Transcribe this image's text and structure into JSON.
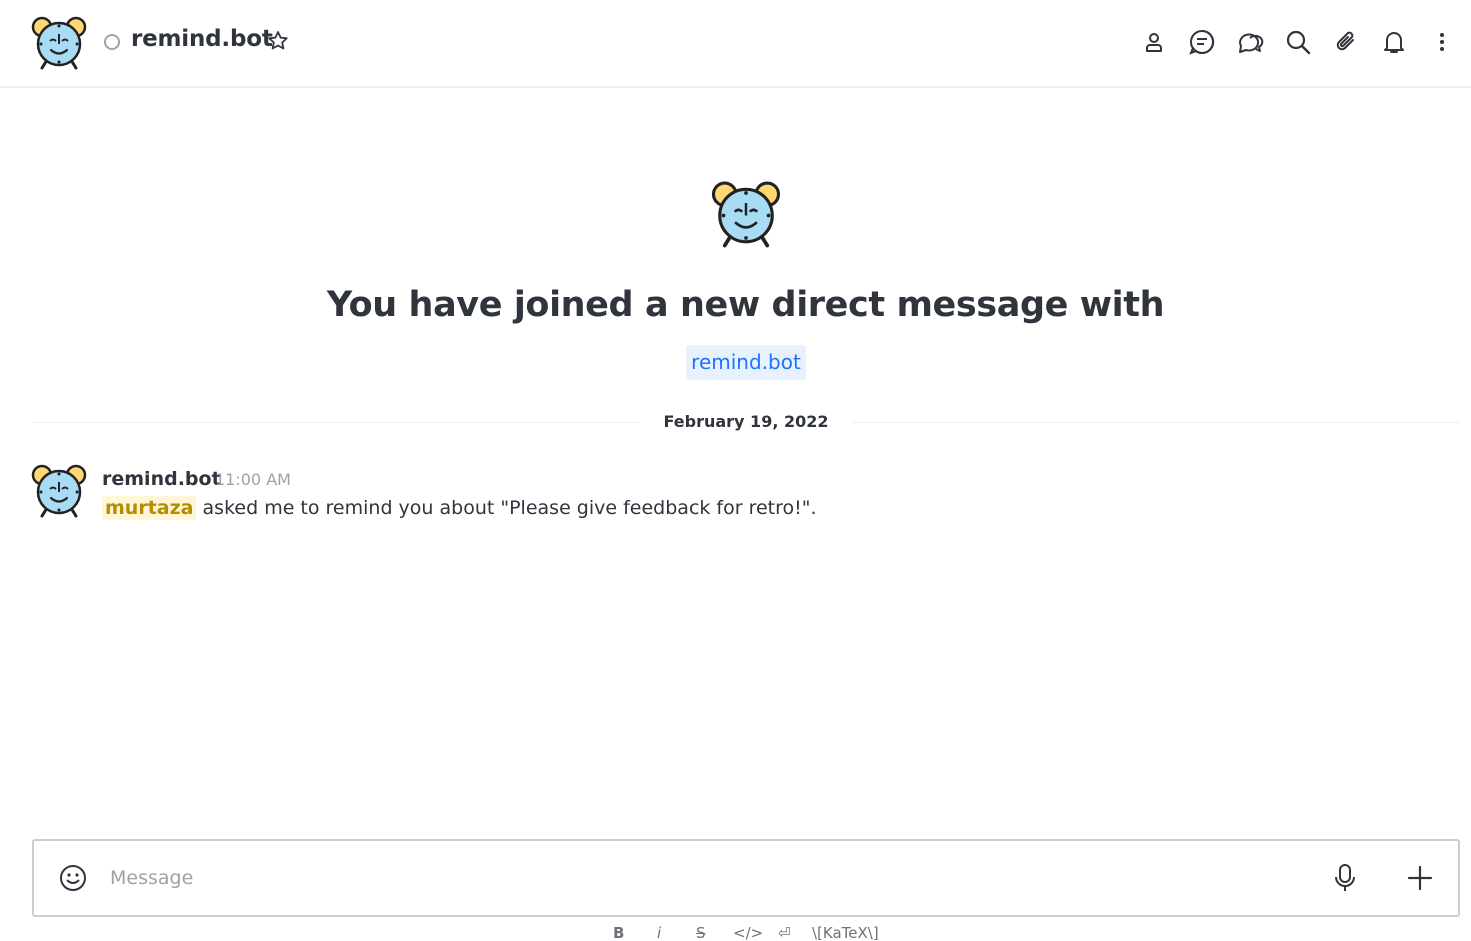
{
  "header": {
    "room_name": "remind.bot",
    "status": "offline",
    "icons": [
      "user-info-icon",
      "discussion-icon",
      "threads-icon",
      "search-icon",
      "files-icon",
      "notifications-icon",
      "kebab-menu-icon"
    ]
  },
  "intro": {
    "title": "You have joined a new direct message with",
    "username": "remind.bot"
  },
  "date_divider": "February 19, 2022",
  "message": {
    "author": "remind.bot",
    "time": "11:00 AM",
    "mention": "murtaza",
    "text": "asked me to remind you about \"Please give feedback for retro!\"."
  },
  "composer": {
    "placeholder": "Message",
    "value": ""
  },
  "format_bar": {
    "bold": "B",
    "italic": "i",
    "strike": "S",
    "code": "</>",
    "multiline": "⏎",
    "katex": "\\[KaTeX\\]"
  },
  "colors": {
    "accent_blue": "#1d74f5",
    "mention_bg": "#fff6d6",
    "mention_fg": "#b68d00",
    "text": "#2f343d",
    "muted": "#9ea2a8"
  }
}
